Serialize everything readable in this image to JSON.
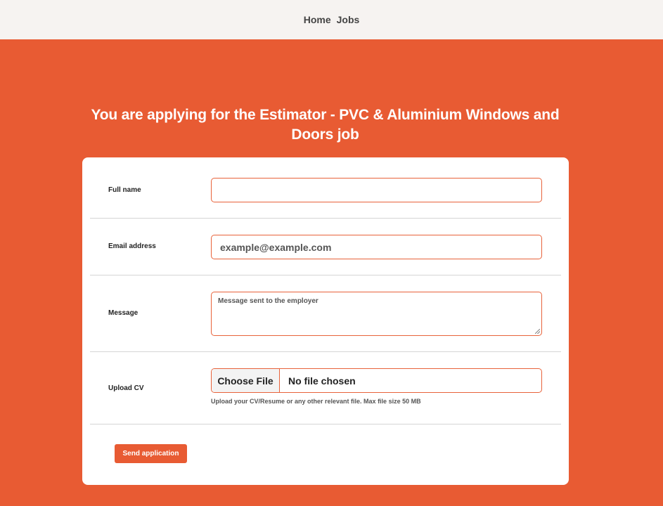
{
  "nav": {
    "home": "Home",
    "jobs": "Jobs"
  },
  "page": {
    "title": "You are applying for the Estimator - PVC & Aluminium Windows and Doors job"
  },
  "form": {
    "full_name": {
      "label": "Full name",
      "value": "",
      "placeholder": ""
    },
    "email": {
      "label": "Email address",
      "value": "",
      "placeholder": "example@example.com"
    },
    "message": {
      "label": "Message",
      "value": "",
      "placeholder": "Message sent to the employer"
    },
    "cv": {
      "label": "Upload CV",
      "button_label": "Choose File",
      "status": "No file chosen",
      "hint": "Upload your CV/Resume or any other relevant file. Max file size 50 MB"
    },
    "submit_label": "Send application"
  },
  "colors": {
    "accent": "#e85b33",
    "nav_bg": "#f6f3f1",
    "card_bg": "#ffffff"
  }
}
